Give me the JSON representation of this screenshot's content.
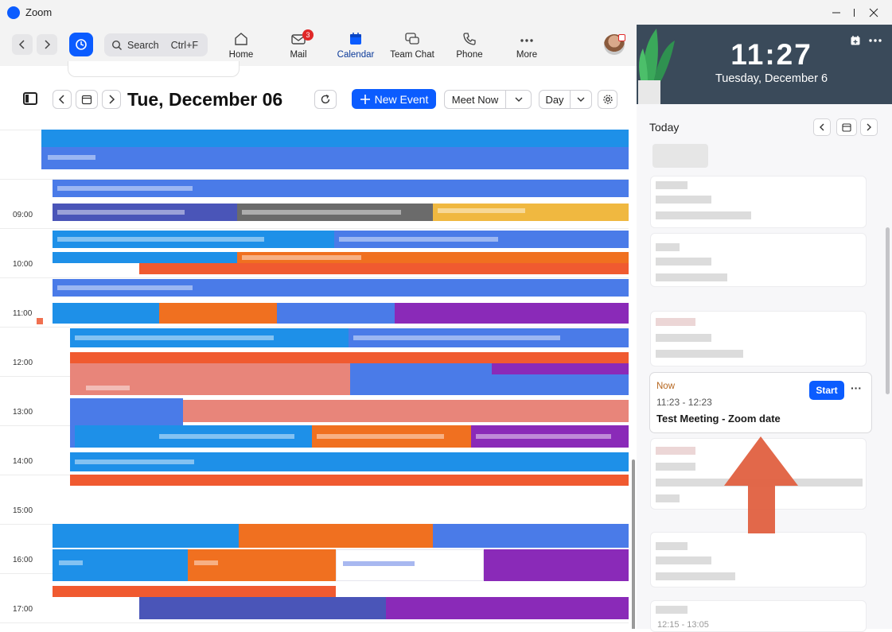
{
  "window": {
    "title": "Zoom",
    "controls": {
      "minimize": "minimize-icon",
      "maximize": "maximize-icon",
      "close": "close-icon"
    }
  },
  "toolbar": {
    "search_placeholder": "Search",
    "search_shortcut": "Ctrl+F",
    "nav": [
      {
        "label": "Home",
        "icon": "home-icon"
      },
      {
        "label": "Mail",
        "icon": "mail-icon",
        "badge": "3"
      },
      {
        "label": "Calendar",
        "icon": "calendar-icon",
        "active": true
      },
      {
        "label": "Team Chat",
        "icon": "chat-icon"
      },
      {
        "label": "Phone",
        "icon": "phone-icon"
      },
      {
        "label": "More",
        "icon": "more-icon"
      }
    ]
  },
  "calendar": {
    "date_title": "Tue, December 06",
    "new_event_label": "New Event",
    "meet_now_label": "Meet Now",
    "view_label": "Day",
    "hours": [
      "09:00",
      "10:00",
      "11:00",
      "12:00",
      "13:00",
      "14:00",
      "15:00",
      "16:00",
      "17:00"
    ]
  },
  "right_panel": {
    "clock_time": "11:27",
    "clock_date": "Tuesday, December 6",
    "today_label": "Today",
    "now_card": {
      "status": "Now",
      "time": "11:23 - 12:23",
      "title": "Test Meeting - Zoom date",
      "start_label": "Start"
    },
    "last_card_time": "12:15 - 13:05"
  },
  "colors": {
    "accent": "#0b5cff",
    "event_blue": "#1e90e8",
    "event_indigo": "#4a7be8",
    "event_orange": "#f07020",
    "event_red": "#f05a30",
    "event_salmon": "#e8857a",
    "event_purple": "#8a2ab8",
    "event_gray": "#6b6b6b",
    "event_yellow": "#f0b840",
    "arrow": "#e06040"
  }
}
